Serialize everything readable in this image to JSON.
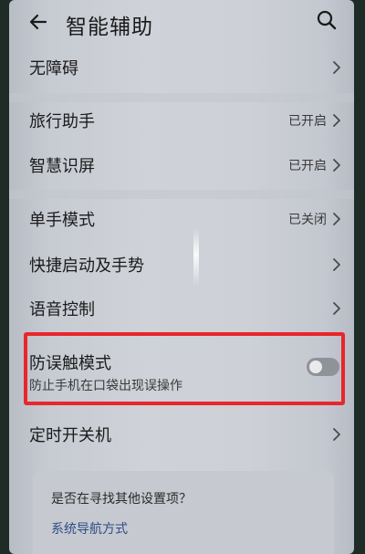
{
  "header": {
    "title": "智能辅助",
    "back_icon": "back-arrow-icon",
    "search_icon": "search-icon"
  },
  "items": [
    {
      "label": "无障碍",
      "status": ""
    },
    {
      "label": "旅行助手",
      "status": "已开启"
    },
    {
      "label": "智慧识屏",
      "status": "已开启"
    },
    {
      "label": "单手模式",
      "status": "已关闭"
    },
    {
      "label": "快捷启动及手势",
      "status": ""
    },
    {
      "label": "语音控制",
      "status": ""
    }
  ],
  "toggle_item": {
    "label": "防误触模式",
    "sub": "防止手机在口袋出现误操作",
    "enabled": false
  },
  "timer_item": {
    "label": "定时开关机"
  },
  "suggestion": {
    "question": "是否在寻找其他设置项？",
    "link": "系统导航方式"
  },
  "colors": {
    "highlight": "#e8262b",
    "link": "#2d4d86"
  }
}
